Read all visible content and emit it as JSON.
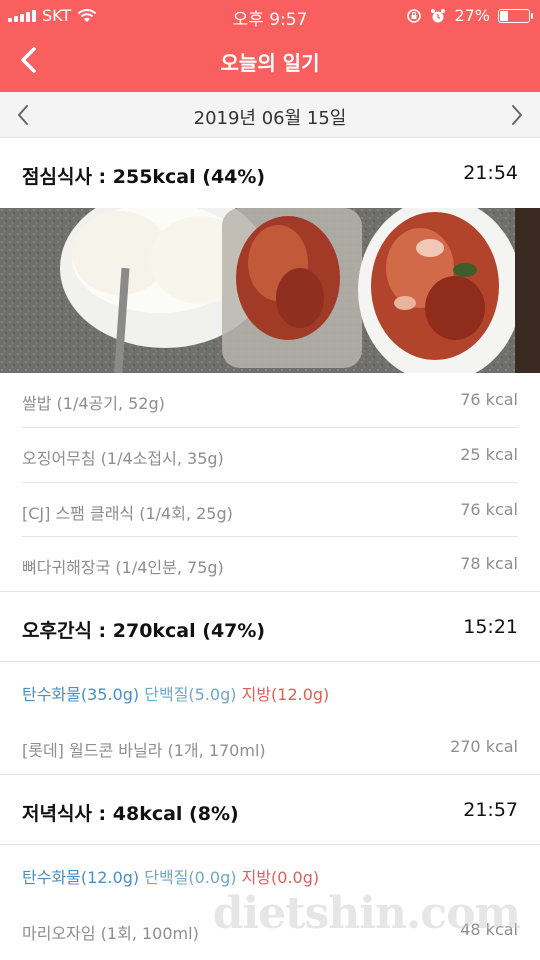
{
  "status": {
    "carrier": "SKT",
    "time": "오후 9:57",
    "battery": "27%",
    "battery_level": 0.27
  },
  "header": {
    "title": "오늘의 일기"
  },
  "date_nav": {
    "date": "2019년 06월 15일"
  },
  "meals": [
    {
      "title": "점심식사 : 255kcal (44%)",
      "time": "21:54",
      "foods": [
        {
          "name": "쌀밥 (1/4공기, 52g)",
          "kcal": "76 kcal"
        },
        {
          "name": "오징어무침 (1/4소접시, 35g)",
          "kcal": "25 kcal"
        },
        {
          "name": "[CJ] 스팸 클래식 (1/4회, 25g)",
          "kcal": "76 kcal"
        },
        {
          "name": "뼈다귀해장국 (1/4인분, 75g)",
          "kcal": "78 kcal"
        }
      ]
    },
    {
      "title": "오후간식 : 270kcal (47%)",
      "time": "15:21",
      "nutrients": {
        "carb": "탄수화물(35.0g)",
        "protein": "단백질(5.0g)",
        "fat": "지방(12.0g)"
      },
      "foods": [
        {
          "name": "[롯데] 월드콘 바닐라 (1개, 170ml)",
          "kcal": "270 kcal"
        }
      ]
    },
    {
      "title": "저녁식사 : 48kcal (8%)",
      "time": "21:57",
      "nutrients": {
        "carb": "탄수화물(12.0g)",
        "protein": "단백질(0.0g)",
        "fat": "지방(0.0g)"
      },
      "foods": [
        {
          "name": "마리오자임 (1회, 100ml)",
          "kcal": "48 kcal"
        }
      ]
    }
  ],
  "watermark": "dietshin.com",
  "colors": {
    "brand": "#f95f5f",
    "carb": "#4a8fc4",
    "protein": "#6fa9c9",
    "fat": "#e0605a"
  }
}
